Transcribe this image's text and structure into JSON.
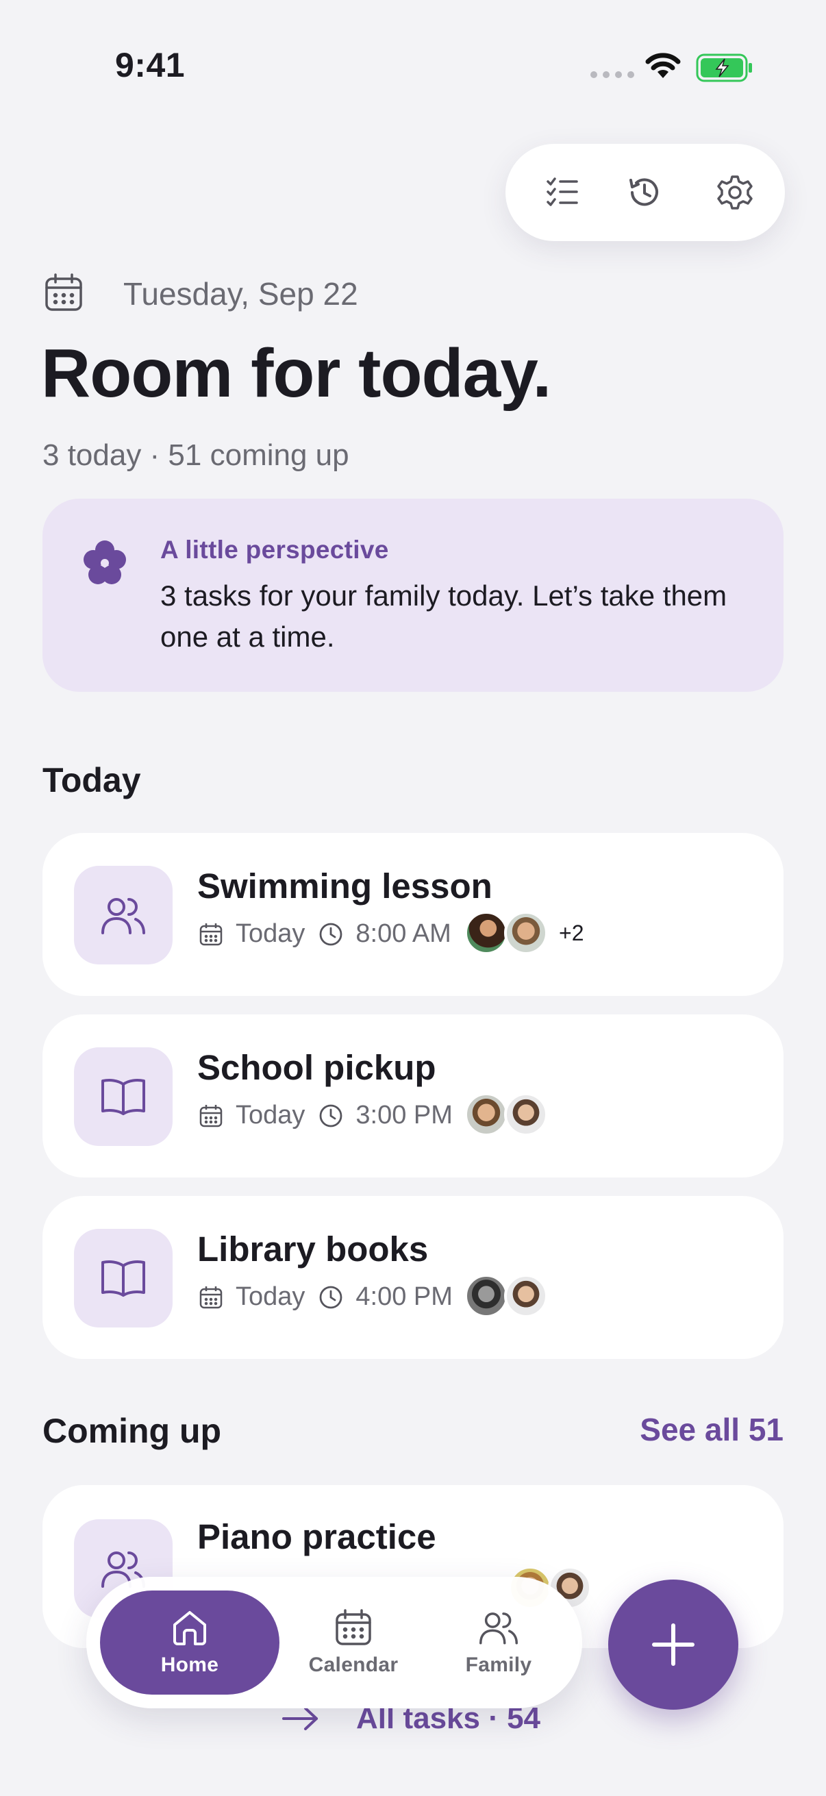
{
  "status_bar": {
    "time": "9:41"
  },
  "toolbar": {
    "items": [
      "checklist-icon",
      "history-icon",
      "gear-icon"
    ]
  },
  "header": {
    "date": "Tuesday, Sep 22",
    "title": "Room for today.",
    "summary": "3 today · 51 coming up"
  },
  "perspective": {
    "label": "A little perspective",
    "text": "3 tasks for your family today. Let’s take them one at a time."
  },
  "today": {
    "title": "Today",
    "tasks": [
      {
        "name": "Swimming lesson",
        "day": "Today",
        "time": "8:00 AM",
        "icon": "people-icon",
        "extra": "+2"
      },
      {
        "name": "School pickup",
        "day": "Today",
        "time": "3:00 PM",
        "icon": "book-icon"
      },
      {
        "name": "Library books",
        "day": "Today",
        "time": "4:00 PM",
        "icon": "book-icon"
      }
    ]
  },
  "coming_up": {
    "title": "Coming up",
    "see_all": "See all 51",
    "tasks": [
      {
        "name": "Piano practice",
        "icon": "people-icon"
      }
    ]
  },
  "nav": {
    "items": [
      {
        "label": "Home",
        "icon": "home-icon",
        "active": true
      },
      {
        "label": "Calendar",
        "icon": "calendar-icon"
      },
      {
        "label": "Family",
        "icon": "people-icon"
      }
    ]
  },
  "footer": {
    "all_tasks": "All tasks · 54"
  },
  "colors": {
    "accent": "#6a4a9c",
    "accent_soft": "#ebe4f5",
    "background": "#f3f3f6",
    "battery": "#34c759"
  }
}
